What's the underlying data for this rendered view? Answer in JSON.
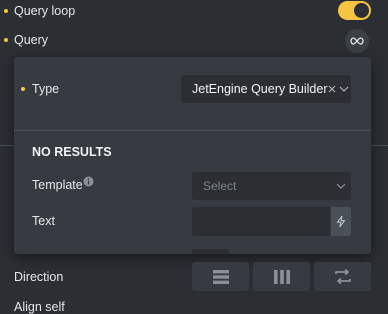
{
  "query_loop": {
    "label": "Query loop",
    "enabled": true
  },
  "query": {
    "label": "Query",
    "icon": "infinity-icon"
  },
  "popup": {
    "type_label": "Type",
    "type_value": "JetEngine Query Builder",
    "no_results_heading": "NO RESULTS",
    "template_label": "Template",
    "template_placeholder": "Select",
    "text_label": "Text",
    "text_value": ""
  },
  "direction": {
    "label": "Direction",
    "options": [
      {
        "icon": "rows-icon"
      },
      {
        "icon": "columns-icon"
      },
      {
        "icon": "reverse-icon"
      }
    ]
  },
  "align_self": {
    "label": "Align self"
  },
  "colors": {
    "accent": "#f5c542",
    "panel": "#363b41",
    "background": "#2b2f33"
  }
}
